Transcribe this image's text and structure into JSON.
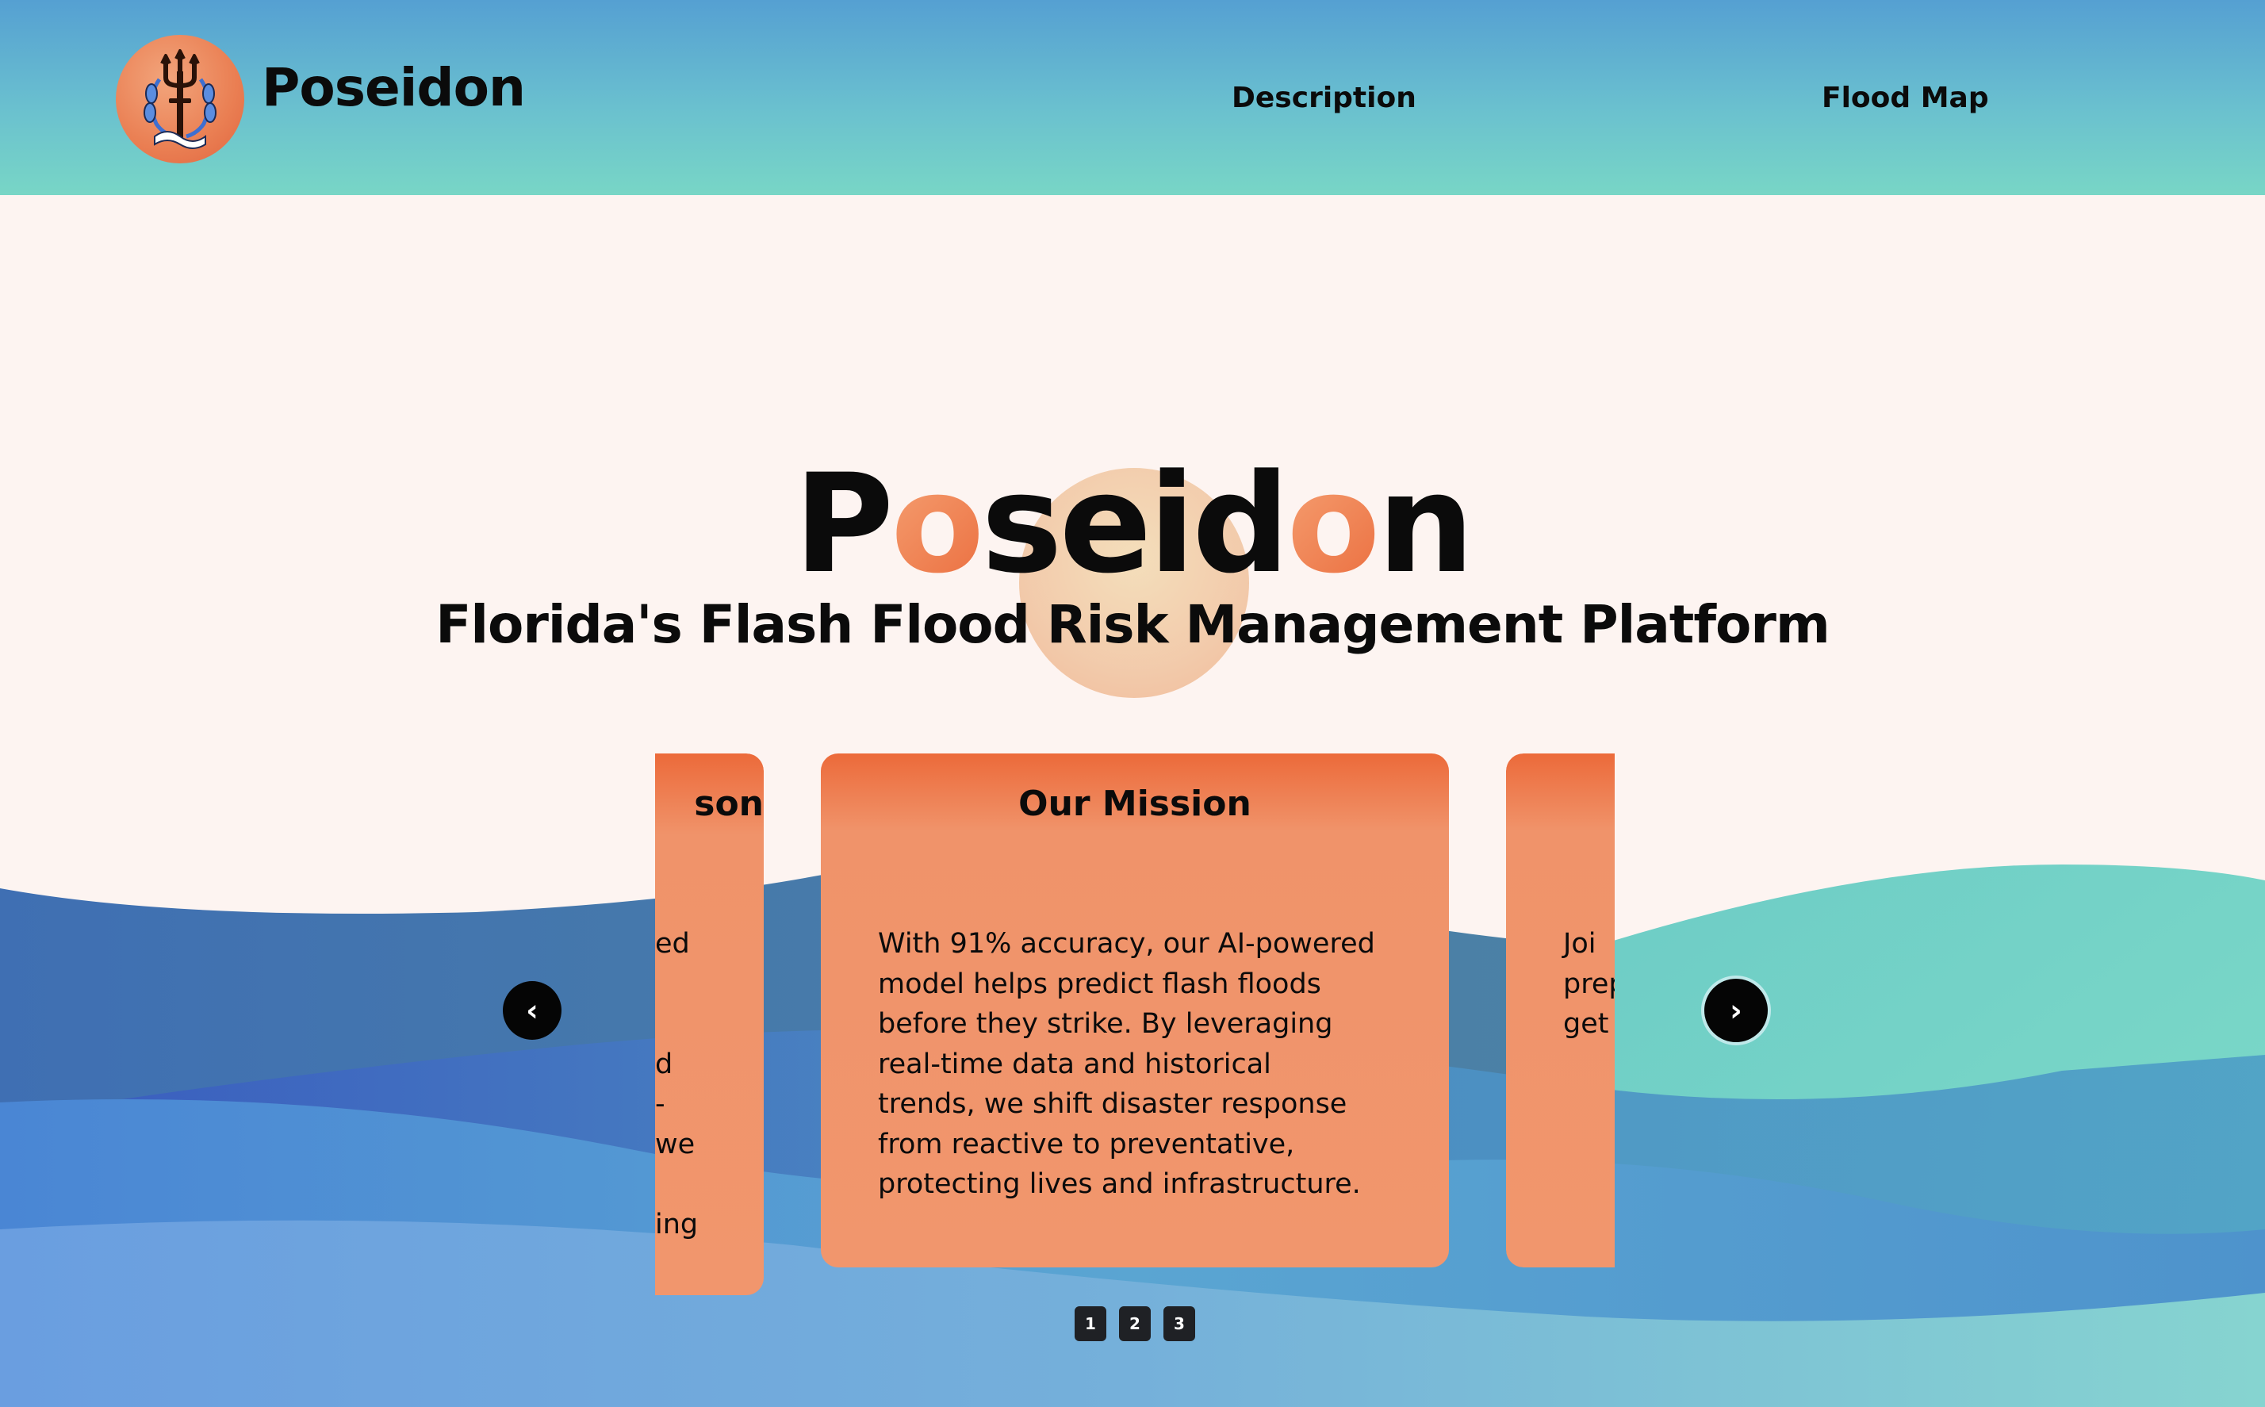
{
  "header": {
    "brand_name": "Poseidon",
    "logo_icon": "trident-icon",
    "nav": [
      {
        "label": "Description"
      },
      {
        "label": "Flood Map"
      }
    ]
  },
  "hero": {
    "title_parts": [
      "P",
      "o",
      "seid",
      "o",
      "n"
    ],
    "subtitle": "Florida's Flash Flood Risk Management Platform"
  },
  "carousel": {
    "left_card": {
      "title_fragment": "son",
      "body_lines": [
        "ed",
        "",
        "",
        "d",
        "-",
        "we",
        "",
        "ing"
      ]
    },
    "center_card": {
      "title": "Our Mission",
      "body_lines": [
        "With 91% accuracy, our AI-powered",
        "model helps predict flash floods",
        "before they strike. By leveraging",
        "real-time data and historical",
        "trends, we shift disaster response",
        "from reactive to preventative,",
        "protecting lives and infrastructure."
      ]
    },
    "right_card": {
      "body_lines": [
        "Joi",
        "prep",
        "get"
      ]
    },
    "prev_label": "‹",
    "next_label": "›",
    "pages": [
      "1",
      "2",
      "3"
    ]
  },
  "colors": {
    "header_top": "#55a0d2",
    "header_bottom": "#78d6c6",
    "card_orange": "#f1966d",
    "card_orange_dark": "#ec6a3a",
    "accent_orange": "#ea6b3c",
    "background": "#fdf4f1"
  }
}
